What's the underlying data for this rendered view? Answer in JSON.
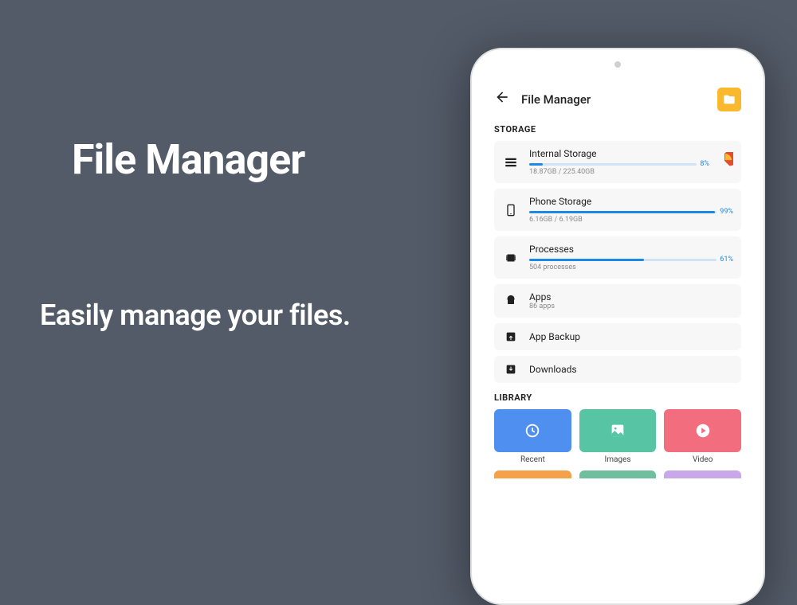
{
  "promo": {
    "title": "File Manager",
    "subtitle": "Easily manage your files."
  },
  "appbar": {
    "title": "File Manager"
  },
  "sections": {
    "storage": "STORAGE",
    "library": "LIBRARY"
  },
  "storage": {
    "internal": {
      "title": "Internal Storage",
      "pct": "8%",
      "pctNum": 8,
      "sub": "18.87GB / 225.40GB"
    },
    "phone": {
      "title": "Phone Storage",
      "pct": "99%",
      "pctNum": 99,
      "sub": "6.16GB / 6.19GB"
    },
    "processes": {
      "title": "Processes",
      "pct": "61%",
      "pctNum": 61,
      "sub": "504 processes"
    },
    "apps": {
      "title": "Apps",
      "sub": "86 apps"
    },
    "backup": {
      "title": "App Backup"
    },
    "downloads": {
      "title": "Downloads"
    }
  },
  "library": {
    "recent": {
      "label": "Recent",
      "color": "#4e8ff0"
    },
    "images": {
      "label": "Images",
      "color": "#57c5a4"
    },
    "video": {
      "label": "Video",
      "color": "#f26d7d"
    },
    "row2": [
      "#f5a14a",
      "#6fbf9e",
      "#c8a8e9"
    ]
  },
  "colors": {
    "accent": "#f9b82e",
    "pie1": "#e64a2f",
    "pie2": "#f9b82e"
  }
}
